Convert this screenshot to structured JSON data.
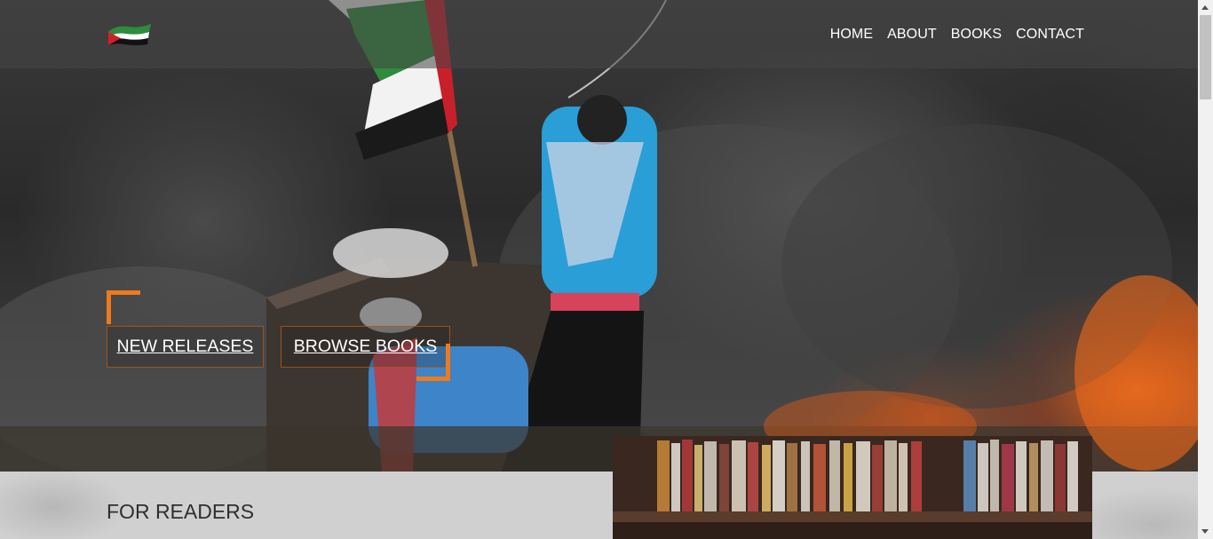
{
  "nav": {
    "logo": "palestine-flag-logo",
    "items": [
      {
        "label": "HOME"
      },
      {
        "label": "ABOUT"
      },
      {
        "label": "BOOKS"
      },
      {
        "label": "CONTACT"
      }
    ]
  },
  "hero": {
    "buttons": {
      "new_releases": "NEW RELEASES",
      "browse_books": "BROWSE BOOKS"
    },
    "accent_color": "#f07a1c"
  },
  "readers": {
    "title": "FOR READERS"
  }
}
